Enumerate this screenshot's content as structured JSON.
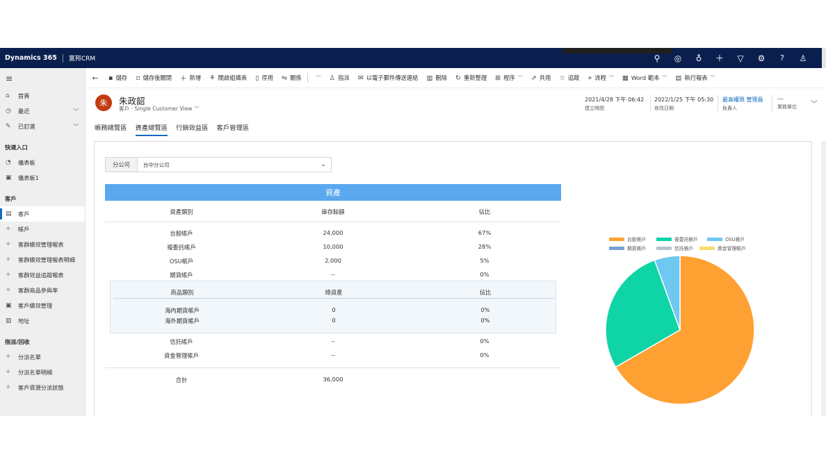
{
  "topbar": {
    "brand": "Dynamics 365",
    "app_name": "富邦CRM",
    "icons": [
      "search-icon",
      "target-icon",
      "lightbulb-icon",
      "plus-icon",
      "filter-icon",
      "gear-icon",
      "help-icon",
      "user-icon"
    ]
  },
  "sidebar": {
    "top_items": [
      {
        "label": "首頁",
        "icon": "home-icon"
      },
      {
        "label": "最近",
        "icon": "clock-icon",
        "chevron": true
      },
      {
        "label": "已釘選",
        "icon": "pin-icon",
        "chevron": true
      }
    ],
    "groups": [
      {
        "title": "快速入口",
        "items": [
          {
            "label": "儀表板"
          },
          {
            "label": "儀表板1"
          }
        ]
      },
      {
        "title": "客戶",
        "items": [
          {
            "label": "客戶",
            "active": true
          },
          {
            "label": "帳戶"
          },
          {
            "label": "客群績效管理報表"
          },
          {
            "label": "客群績效管理報表明細"
          },
          {
            "label": "客群效益追蹤報表"
          },
          {
            "label": "客群商品參與率"
          },
          {
            "label": "客戶績效管理"
          },
          {
            "label": "地址"
          }
        ]
      },
      {
        "title": "指派/回收",
        "items": [
          {
            "label": "分派名單"
          },
          {
            "label": "分派名單明細"
          },
          {
            "label": "客戶資源分派狀態"
          }
        ]
      }
    ]
  },
  "commands": {
    "save": "儲存",
    "save_close": "儲存後關閉",
    "new": "新增",
    "open_org": "開啟組織表",
    "deactivate": "停用",
    "relations": "關係",
    "assign": "指派",
    "email_link": "以電子郵件傳送連結",
    "delete": "刪除",
    "refresh": "重新整理",
    "process": "程序",
    "share": "共用",
    "follow": "追蹤",
    "flow": "流程",
    "word_template": "Word 範本",
    "run_report": "執行報表"
  },
  "record": {
    "avatar_initial": "朱",
    "name": "朱政韶",
    "entity": "客戶",
    "form": "Single Customer View",
    "fields": [
      {
        "value": "2021/4/28 下午 06:42",
        "label": "建立時間"
      },
      {
        "value": "2022/1/25 下午 05:30",
        "label": "修改日期"
      },
      {
        "value": "最高權限 管理員",
        "label": "負責人",
        "link": true
      },
      {
        "value": "---",
        "label": "業務單位"
      }
    ]
  },
  "tabs": [
    "帳務總覽區",
    "資產總覽區",
    "行銷效益區",
    "客戶管理區"
  ],
  "filter": {
    "label": "分公司",
    "value": "台中分公司"
  },
  "assets": {
    "title": "資產",
    "headers": [
      "資產類別",
      "庫存餘額",
      "佔比"
    ],
    "rows": [
      {
        "name": "台股帳戶",
        "balance": "24,000",
        "pct": "67%"
      },
      {
        "name": "複委託帳戶",
        "balance": "10,000",
        "pct": "28%"
      },
      {
        "name": "OSU帳戶",
        "balance": "2,000",
        "pct": "5%"
      },
      {
        "name": "期貨帳戶",
        "balance": "--",
        "pct": "0%"
      }
    ],
    "sub": {
      "headers": [
        "商品類別",
        "總資產",
        "佔比"
      ],
      "rows": [
        {
          "name": "海內期貨帳戶",
          "balance": "0",
          "pct": "0%"
        },
        {
          "name": "海外期貨帳戶",
          "balance": "0",
          "pct": "0%"
        }
      ]
    },
    "rows2": [
      {
        "name": "信託帳戶",
        "balance": "--",
        "pct": "0%"
      },
      {
        "name": "資金管理帳戶",
        "balance": "--",
        "pct": "0%"
      }
    ],
    "total_label": "合計",
    "total_value": "36,000"
  },
  "chart_data": {
    "type": "pie",
    "legend_position": "top",
    "slices": [
      {
        "label": "台股帳戶",
        "value": 24000,
        "color": "#ffa033"
      },
      {
        "label": "複委託帳戶",
        "value": 10000,
        "color": "#0fd4a6"
      },
      {
        "label": "OSU帳戶",
        "value": 2000,
        "color": "#6ec8f2"
      },
      {
        "label": "期貨帳戶",
        "value": 0,
        "color": "#7aa0d4"
      },
      {
        "label": "信託帳戶",
        "value": 0,
        "color": "#b9c3cb"
      },
      {
        "label": "資金管理帳戶",
        "value": 0,
        "color": "#f8dc6a"
      }
    ]
  }
}
